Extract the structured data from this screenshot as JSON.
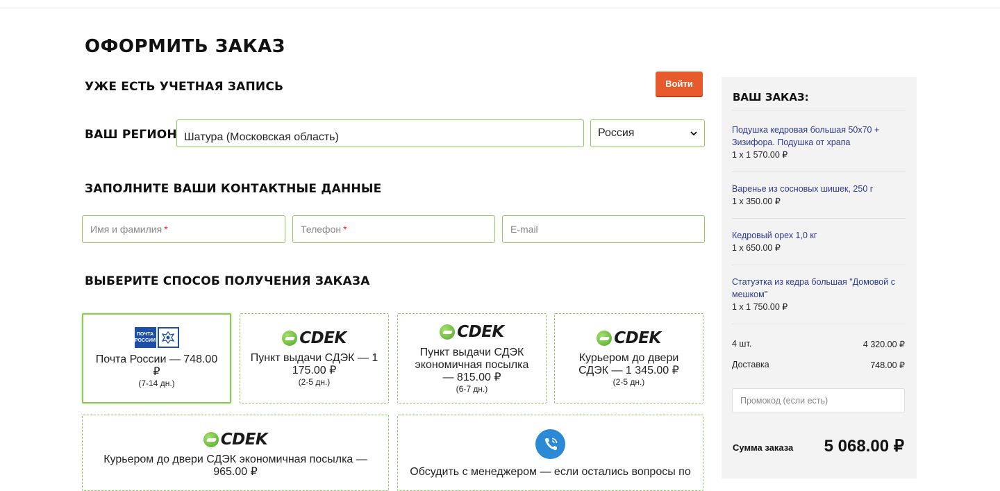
{
  "page": {
    "title": "ОФОРМИТЬ ЗАКАЗ"
  },
  "account": {
    "heading": "УЖЕ ЕСТЬ УЧЕТНАЯ ЗАПИСЬ",
    "login_label": "Войти"
  },
  "region": {
    "heading": "ВАШ РЕГИОН",
    "city_value": "Шатура (Московская область)",
    "country_selected": "Россия"
  },
  "contacts": {
    "heading": "ЗАПОЛНИТЕ ВАШИ КОНТАКТНЫЕ ДАННЫЕ",
    "name_placeholder": "Имя и фамилия",
    "phone_placeholder": "Телефон",
    "email_placeholder": "E-mail",
    "required_mark": "*"
  },
  "delivery": {
    "heading": "ВЫБЕРИТЕ СПОСОБ ПОЛУЧЕНИЯ ЗАКАЗА",
    "pochta_logo_text": "ПОЧТА РОССИИ",
    "cdek_logo_text": "CDEK",
    "options": [
      {
        "label": "Почта России — 748.00 ₽",
        "days": "(7-14 дн.)",
        "logo": "pochta-icon",
        "selected": true
      },
      {
        "label": "Пункт выдачи СДЭК — 1 175.00 ₽",
        "days": "(2-5 дн.)",
        "logo": "cdek-icon",
        "selected": false
      },
      {
        "label": "Пункт выдачи СДЭК экономичная посылка — 815.00 ₽",
        "days": "(6-7 дн.)",
        "logo": "cdek-icon",
        "selected": false
      },
      {
        "label": "Курьером до двери СДЭК — 1 345.00 ₽",
        "days": "(2-5 дн.)",
        "logo": "cdek-icon",
        "selected": false
      },
      {
        "label": "Курьером до двери СДЭК экономичная посылка — 965.00 ₽",
        "days": "",
        "logo": "cdek-icon",
        "selected": false
      },
      {
        "label": "Обсудить с менеджером — если остались вопросы по",
        "days": "",
        "logo": "phone-icon",
        "selected": false
      }
    ]
  },
  "order": {
    "heading": "ВАШ ЗАКАЗ:",
    "items": [
      {
        "name": "Подушка кедровая большая 50х70 + Зизифора. Подушка от храпа",
        "qty": "1 x 1 570.00 ₽"
      },
      {
        "name": "Варенье из сосновых шишек, 250 г",
        "qty": "1 x 350.00 ₽"
      },
      {
        "name": "Кедровый орех 1,0 кг",
        "qty": "1 x 650.00 ₽"
      },
      {
        "name": "Статуэтка из кедра большая \"Домовой с мешком\"",
        "qty": "1 x 1 750.00 ₽"
      }
    ],
    "count_label": "4 шт.",
    "count_value": "4 320.00 ₽",
    "delivery_label": "Доставка",
    "delivery_value": "748.00 ₽",
    "promo_placeholder": "Промокод (если есть)",
    "total_label": "Сумма заказа",
    "total_value": "5 068.00 ₽"
  },
  "colors": {
    "accent": "#e85a2c",
    "field_border": "#8cc85a",
    "link": "#2b3a8c",
    "sidebar_bg": "#f3f3f3"
  }
}
